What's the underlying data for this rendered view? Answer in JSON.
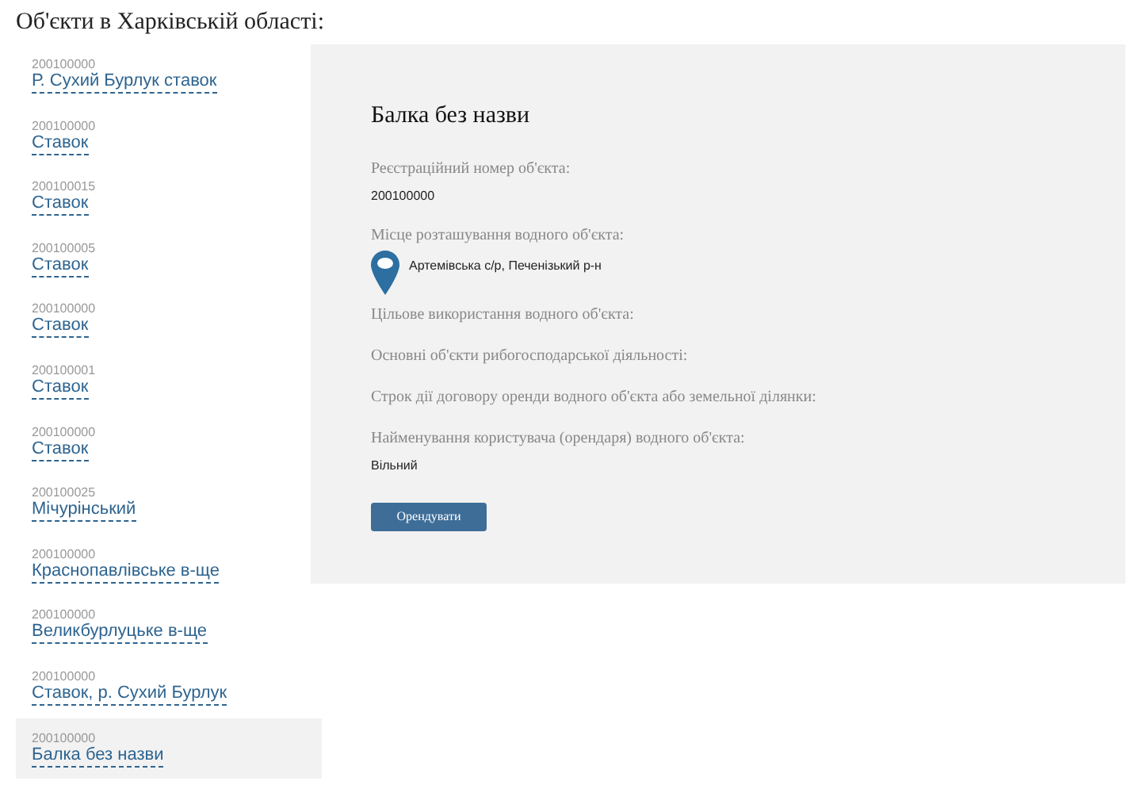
{
  "heading": "Об'єкти в Харківській області:",
  "objects": [
    {
      "code": "200100000",
      "name": "Р. Сухий Бурлук ставок",
      "selected": false
    },
    {
      "code": "200100000",
      "name": "Ставок",
      "selected": false
    },
    {
      "code": "200100015",
      "name": "Ставок",
      "selected": false
    },
    {
      "code": "200100005",
      "name": "Ставок",
      "selected": false
    },
    {
      "code": "200100000",
      "name": "Ставок",
      "selected": false
    },
    {
      "code": "200100001",
      "name": "Ставок",
      "selected": false
    },
    {
      "code": "200100000",
      "name": "Ставок",
      "selected": false
    },
    {
      "code": "200100025",
      "name": "Мічурінський",
      "selected": false
    },
    {
      "code": "200100000",
      "name": "Краснопавлівське в-ще",
      "selected": false
    },
    {
      "code": "200100000",
      "name": "Великбурлуцьке в-ще",
      "selected": false
    },
    {
      "code": "200100000",
      "name": "Ставок, р. Сухий Бурлук",
      "selected": false
    },
    {
      "code": "200100000",
      "name": "Балка без назви",
      "selected": true
    }
  ],
  "detail": {
    "title": "Балка без назви",
    "fields": [
      {
        "label": "Реєстраційний номер об'єкта:",
        "value": "200100000",
        "kind": "text"
      },
      {
        "label": "Місце розташування водного об'єкта:",
        "value": "Артемівська с/р, Печенізький р-н",
        "kind": "location"
      },
      {
        "label": "Цільове використання водного об'єкта:",
        "kind": "text"
      },
      {
        "label": "Основні об'єкти рибогосподарської діяльності:",
        "kind": "text"
      },
      {
        "label": "Строк дії договору оренди водного об'єкта або земельної ділянки:",
        "kind": "text"
      },
      {
        "label": "Найменування користувача (орендаря) водного об'єкта:",
        "value": "Вільний",
        "kind": "text"
      }
    ],
    "button": "Орендувати"
  }
}
